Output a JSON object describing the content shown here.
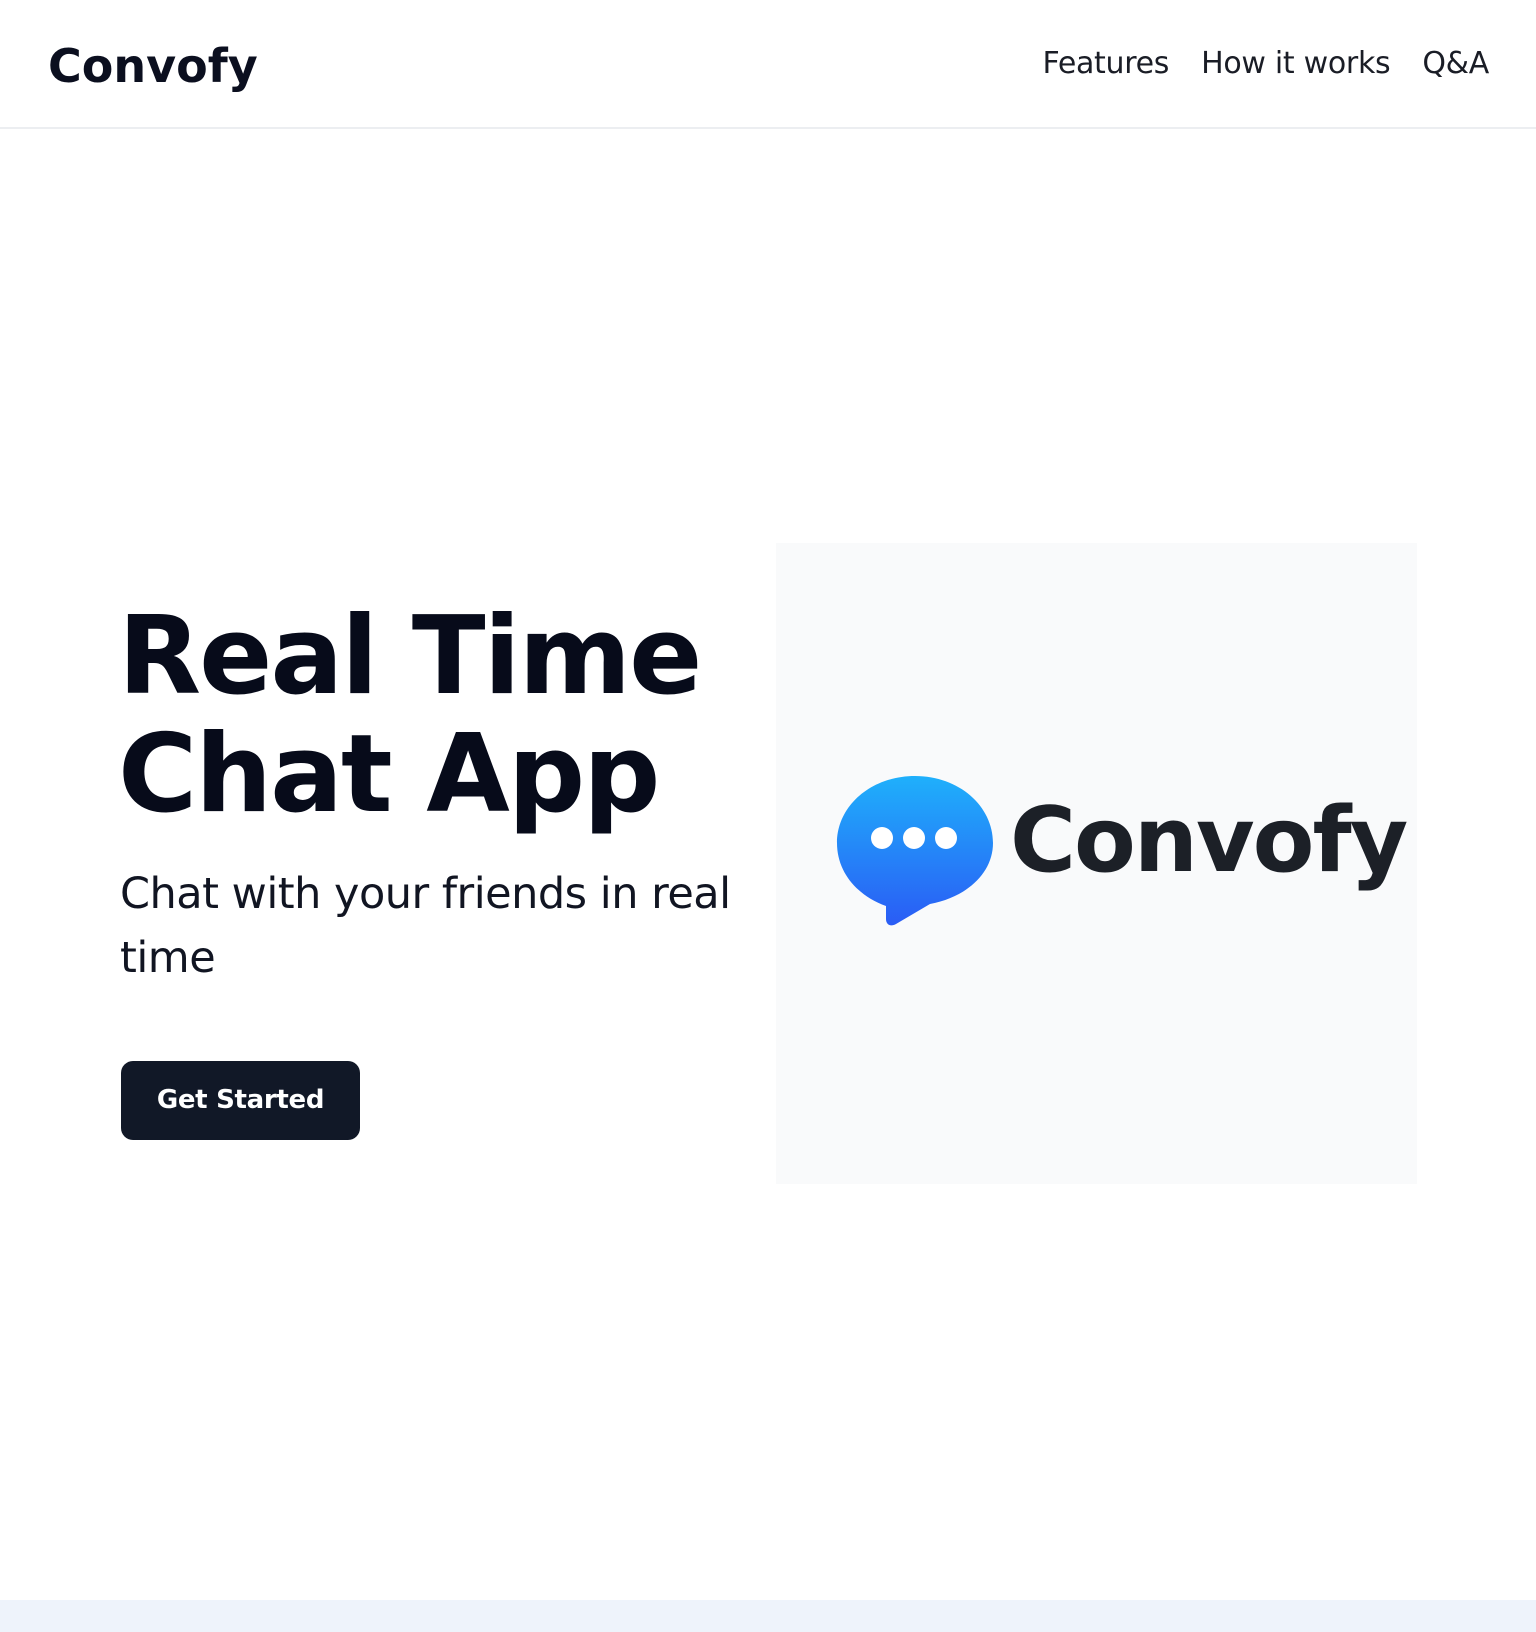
{
  "header": {
    "brand": "Convofy",
    "nav": [
      {
        "label": "Features"
      },
      {
        "label": "How it works"
      },
      {
        "label": "Q&A"
      }
    ]
  },
  "hero": {
    "title_line1": "Real Time",
    "title_line2": "Chat App",
    "subtitle": "Chat with your friends in real time",
    "cta_label": "Get Started"
  },
  "logo": {
    "wordmark": "Convofy",
    "icon": "chat-bubble-ellipsis-icon",
    "gradient_top": "#1fb0fb",
    "gradient_bottom": "#2a5cf5"
  },
  "colors": {
    "text_dark": "#0b0f1f",
    "button_bg": "#111827",
    "panel_bg": "#f9fafb",
    "footer_strip": "#eef3fb"
  }
}
